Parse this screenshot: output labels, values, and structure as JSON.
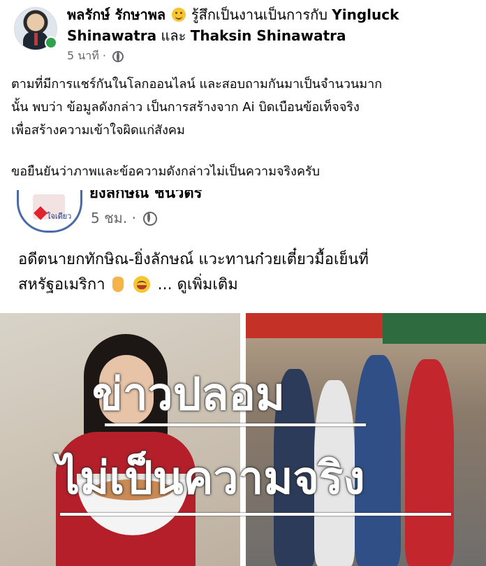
{
  "post1": {
    "author": "พลรักษ์ รักษาพล",
    "feeling": "รู้สึกเป็นงานเป็นการกับ",
    "tag1": "Yingluck Shinawatra",
    "conj": "และ",
    "tag2": "Thaksin Shinawatra",
    "time": "5 นาที",
    "dot": "·",
    "line1": "ตามที่มีการแชร์กันในโลกออนไลน์ และสอบถามกันมาเป็นจำนวนมาก",
    "line2": "นั้น พบว่า ข้อมูลดังกล่าว เป็นการสร้างจาก Ai บิดเบือนข้อเท็จจริง",
    "line3": "เพื่อสร้างความเข้าใจผิดแก่สังคม",
    "line4": "ขอยืนยันว่าภาพและข้อความดังกล่าวไม่เป็นความจริงครับ"
  },
  "post2": {
    "avatar_text": "ใจเดียว",
    "author": "ยิ่งลักษณ์ ชินวัตร",
    "time": "5 ชม.",
    "dot": "·",
    "line1": "อดีตนายกทักษิณ-ยิ่งลักษณ์ แวะทานก๋วยเตี๋ยวมื้อเย็นที่",
    "line2": "สหรัฐอเมริกา",
    "ellipsis": "...",
    "see_more": "ดูเพิ่มเติม",
    "overlay_top": "ข่าวปลอม",
    "overlay_bottom": "ไม่เป็นความจริง"
  }
}
